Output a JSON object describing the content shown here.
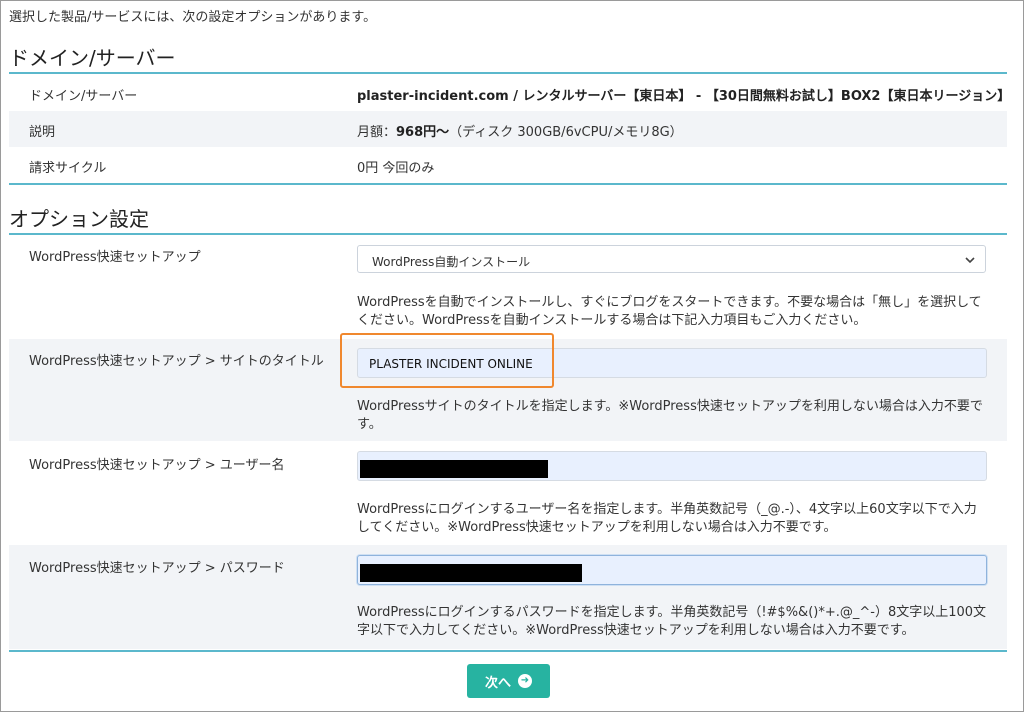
{
  "intro_text": "選択した製品/サービスには、次の設定オプションがあります。",
  "domain_section": {
    "title": "ドメイン/サーバー",
    "rows": [
      {
        "label": "ドメイン/サーバー",
        "value": "plaster-incident.com / レンタルサーバー【東日本】 - 【30日間無料お試し】BOX2【東日本リージョン】"
      },
      {
        "label": "説明",
        "value_prefix": "月額：",
        "value_bold": "968円〜",
        "value_suffix": "（ディスク 300GB/6vCPU/メモリ8G）"
      },
      {
        "label": "請求サイクル",
        "value": "0円 今回のみ"
      }
    ]
  },
  "options_section": {
    "title": "オプション設定",
    "wp_setup": {
      "label": "WordPress快速セットアップ",
      "selected": "WordPress自動インストール",
      "help": "WordPressを自動でインストールし、すぐにブログをスタートできます。不要な場合は「無し」を選択してください。WordPressを自動インストールする場合は下記入力項目もご入力ください。"
    },
    "site_title": {
      "label": "WordPress快速セットアップ > サイトのタイトル",
      "value": "PLASTER INCIDENT ONLINE",
      "help": "WordPressサイトのタイトルを指定します。※WordPress快速セットアップを利用しない場合は入力不要です。"
    },
    "username": {
      "label": "WordPress快速セットアップ > ユーザー名",
      "help": "WordPressにログインするユーザー名を指定します。半角英数記号（_@.-）、4文字以上60文字以下で入力してください。※WordPress快速セットアップを利用しない場合は入力不要です。"
    },
    "password": {
      "label": "WordPress快速セットアップ > パスワード",
      "help": "WordPressにログインするパスワードを指定します。半角英数記号（!#$%&()*+.@_^-）8文字以上100文字以下で入力してください。※WordPress快速セットアップを利用しない場合は入力不要です。"
    }
  },
  "next_button": {
    "label": "次へ",
    "icon": "arrow-circle-right-icon"
  },
  "colors": {
    "accent": "#5bb8cc",
    "button": "#27b3a1",
    "highlight": "#f0882e",
    "input_bg": "#e8f0fe"
  }
}
